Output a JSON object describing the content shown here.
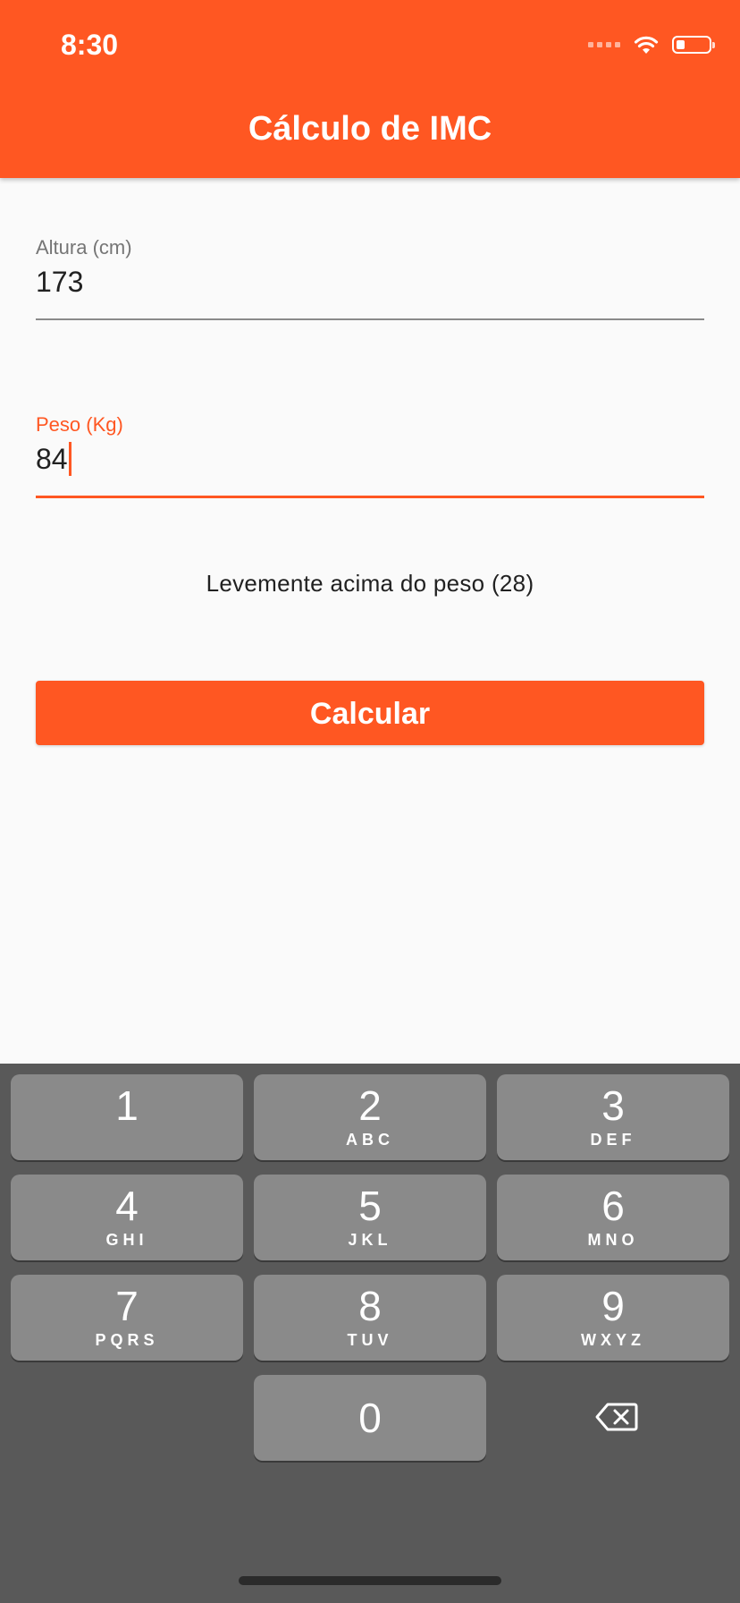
{
  "status_bar": {
    "time": "8:30",
    "icons": [
      "signal-icon",
      "wifi-icon",
      "battery-icon"
    ]
  },
  "app_bar": {
    "title": "Cálculo de IMC",
    "color": "#ff5722"
  },
  "form": {
    "altura": {
      "label": "Altura (cm)",
      "value": "173"
    },
    "peso": {
      "label": "Peso (Kg)",
      "value": "84",
      "focused": true
    }
  },
  "result": {
    "text": "Levemente acima do peso (28)"
  },
  "calculate_button": {
    "label": "Calcular"
  },
  "keyboard": {
    "keys": [
      {
        "digit": "1",
        "letters": ""
      },
      {
        "digit": "2",
        "letters": "ABC"
      },
      {
        "digit": "3",
        "letters": "DEF"
      },
      {
        "digit": "4",
        "letters": "GHI"
      },
      {
        "digit": "5",
        "letters": "JKL"
      },
      {
        "digit": "6",
        "letters": "MNO"
      },
      {
        "digit": "7",
        "letters": "PQRS"
      },
      {
        "digit": "8",
        "letters": "TUV"
      },
      {
        "digit": "9",
        "letters": "WXYZ"
      },
      {
        "digit": "0",
        "letters": ""
      }
    ],
    "backspace_icon": "backspace-icon"
  }
}
